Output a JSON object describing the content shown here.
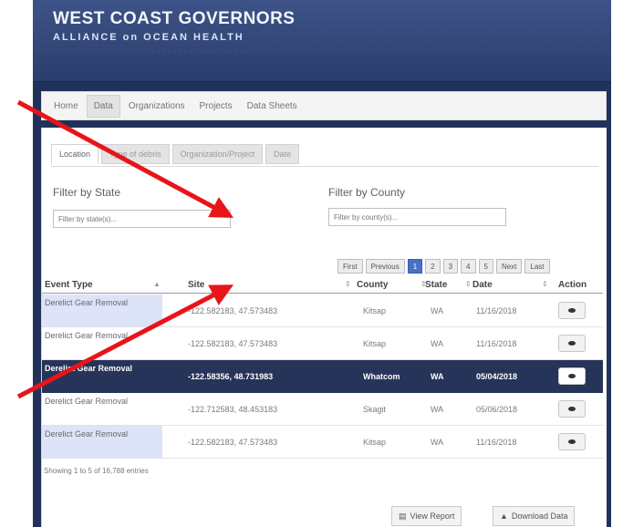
{
  "header": {
    "title": "WEST COAST GOVERNORS",
    "subtitle": "ALLIANCE on OCEAN HEALTH"
  },
  "nav": {
    "items": [
      {
        "label": "Home"
      },
      {
        "label": "Data"
      },
      {
        "label": "Organizations"
      },
      {
        "label": "Projects"
      },
      {
        "label": "Data Sheets"
      }
    ],
    "active": "Data"
  },
  "subtabs": {
    "items": [
      {
        "label": "Location"
      },
      {
        "label": "Type of debris"
      },
      {
        "label": "Organization/Project"
      },
      {
        "label": "Date"
      }
    ],
    "active": "Location"
  },
  "filters": {
    "state": {
      "label": "Filter by State",
      "placeholder": "Filter by state(s)..."
    },
    "county": {
      "label": "Filter by County",
      "placeholder": "Filter by county(s)..."
    }
  },
  "pagination": {
    "first": "First",
    "previous": "Previous",
    "pages": [
      "1",
      "2",
      "3",
      "4",
      "5"
    ],
    "current": "1",
    "next": "Next",
    "last": "Last"
  },
  "table": {
    "columns": [
      "Event Type",
      "Site",
      "County",
      "State",
      "Date",
      "Action"
    ],
    "rows": [
      {
        "event_type": "Derelict Gear Removal",
        "site": "-122.582183, 47.573483",
        "county": "Kitsap",
        "state": "WA",
        "date": "11/16/2018"
      },
      {
        "event_type": "Derelict Gear Removal",
        "site": "-122.582183, 47.573483",
        "county": "Kitsap",
        "state": "WA",
        "date": "11/16/2018"
      },
      {
        "event_type": "Derelict Gear Removal",
        "site": "-122.58356, 48.731983",
        "county": "Whatcom",
        "state": "WA",
        "date": "05/04/2018"
      },
      {
        "event_type": "Derelict Gear Removal",
        "site": "-122.712583, 48.453183",
        "county": "Skagit",
        "state": "WA",
        "date": "05/06/2018"
      },
      {
        "event_type": "Derelict Gear Removal",
        "site": "-122.582183, 47.573483",
        "county": "Kitsap",
        "state": "WA",
        "date": "11/16/2018"
      }
    ],
    "selected_row_index": 2,
    "showing": "Showing 1 to 5 of 16,788 entries"
  },
  "actions": {
    "view_report": "View Report",
    "download_data": "Download Data"
  },
  "icons": {
    "action": "eye-icon",
    "view_report": "report-icon",
    "download_data": "download-icon"
  },
  "colors": {
    "header": "#2f4374",
    "selected_row": "#263459",
    "current_page": "#4a6fc7",
    "annotation_arrow": "#e8141a",
    "tinted_cell": "#dde3f8"
  }
}
